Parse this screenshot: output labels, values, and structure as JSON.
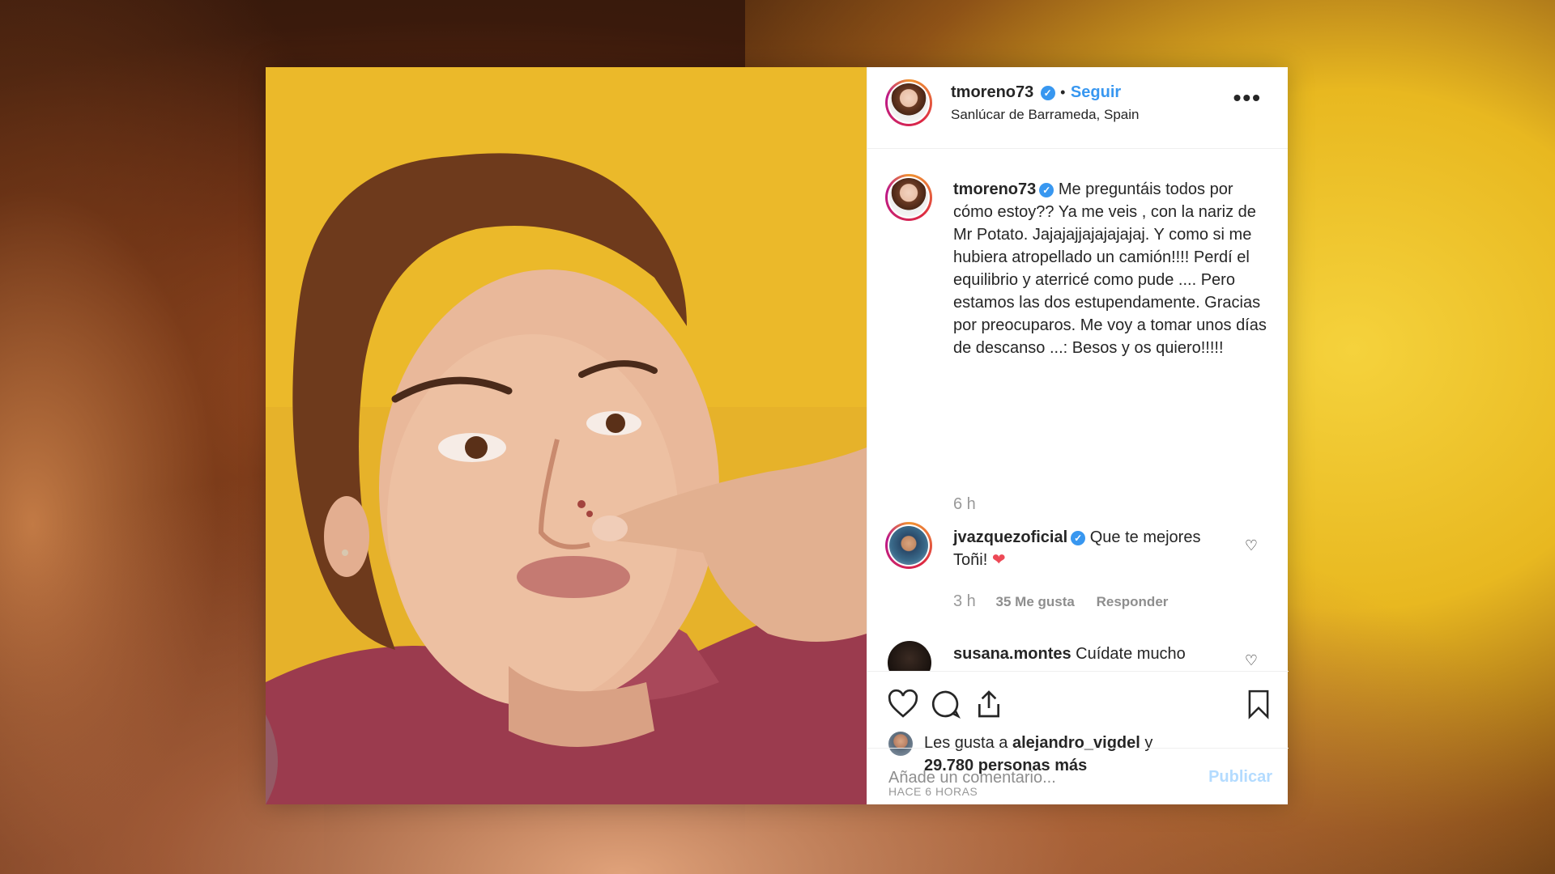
{
  "post": {
    "header": {
      "username": "tmoreno73",
      "separator": "•",
      "follow_label": "Seguir",
      "location": "Sanlúcar de Barrameda, Spain",
      "more_icon": "•••"
    },
    "caption": {
      "username": "tmoreno73",
      "text": "Me preguntáis todos por cómo estoy?? Ya me veis , con la nariz de Mr Potato. Jajajajjajajajajaj. Y como si me hubiera atropellado un camión!!!! Perdí el equilibrio y aterricé como pude .... Pero estamos las dos estupendamente. Gracias por preocuparos. Me voy a tomar unos días de descanso ...: Besos y os quiero!!!!!",
      "time": "6 h"
    },
    "comments": [
      {
        "username": "jvazquezoficial",
        "text": "Que te mejores Toñi!",
        "emoji": "❤",
        "time": "3 h",
        "likes": "35 Me gusta",
        "reply_label": "Responder"
      },
      {
        "username": "susana.montes",
        "text": "Cuídate mucho"
      }
    ],
    "likes": {
      "prefix": "Les gusta a",
      "user": "alejandro_vigdel",
      "connector": "y",
      "count_text": "29.780 personas más"
    },
    "timestamp": "HACE 6 HORAS",
    "add_comment": {
      "placeholder": "Añade un comentario...",
      "publish_label": "Publicar"
    },
    "colors": {
      "accent": "#3897f0",
      "publish_disabled": "#b3dbff",
      "heart_red": "#ed4956"
    },
    "icons": [
      "heart-icon",
      "comment-icon",
      "share-icon",
      "bookmark-icon",
      "more-options-icon",
      "verified-badge-icon"
    ]
  }
}
